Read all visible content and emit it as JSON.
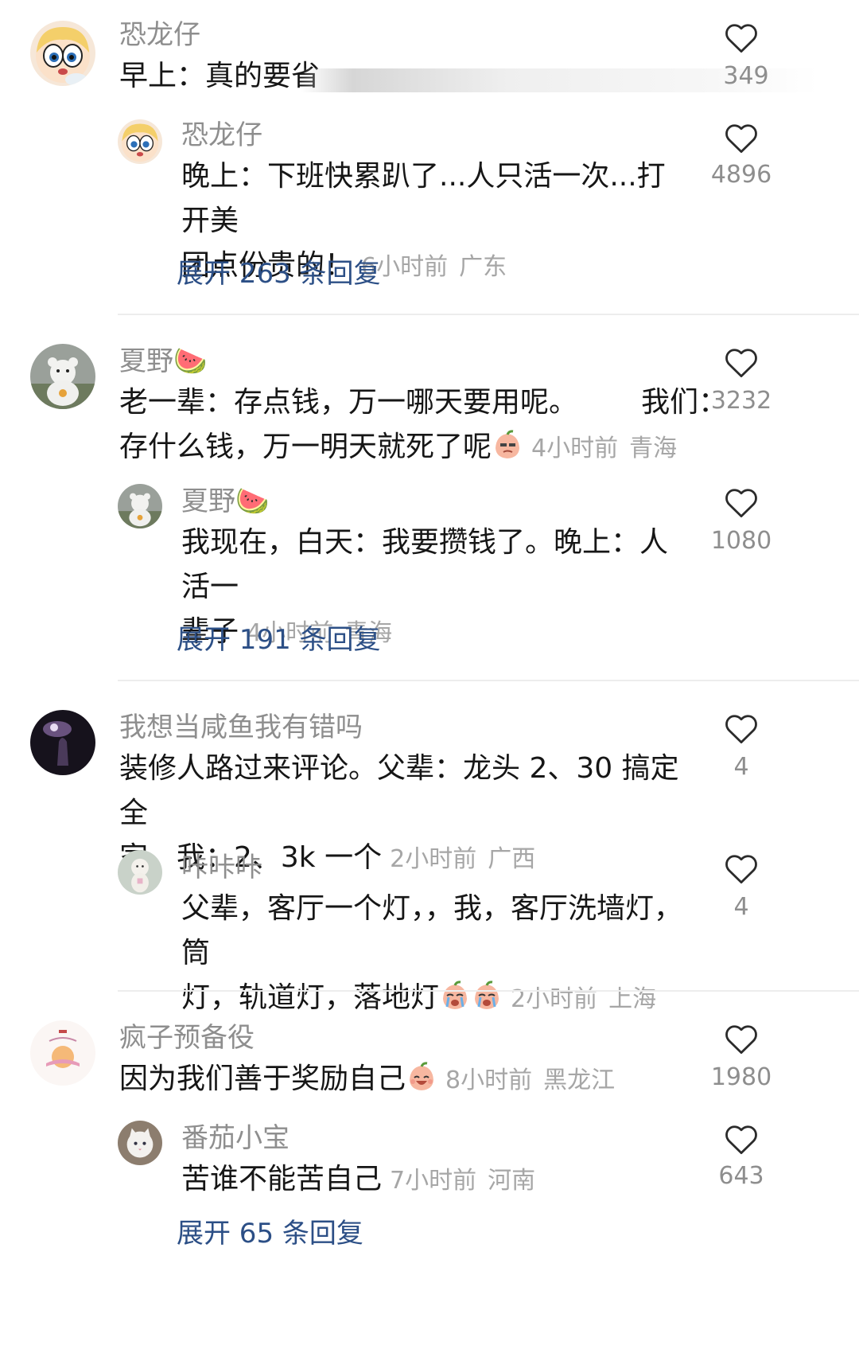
{
  "comments": [
    {
      "username": "恐龙仔",
      "text": "早上：真的要省",
      "likes": "349",
      "reply": {
        "username": "恐龙仔",
        "text_line1": "晚上：下班快累趴了...人只活一次...打开美",
        "text_line2": "团点份贵的！",
        "time": "6小时前",
        "location": "广东",
        "likes": "4896"
      },
      "expand_label": "展开 263 条回复"
    },
    {
      "username": "夏野🍉",
      "text_line1": "老一辈：存点钱，万一哪天要用呢。       我们：",
      "text_line2": "存什么钱，万一明天就死了呢",
      "time": "4小时前",
      "location": "青海",
      "likes": "3232",
      "reply": {
        "username": "夏野🍉",
        "text_line1": "我现在，白天：我要攒钱了。晚上：人活一",
        "text_line2": "辈子",
        "time": "4小时前",
        "location": "青海",
        "likes": "1080"
      },
      "expand_label": "展开 191 条回复"
    },
    {
      "username": "我想当咸鱼我有错吗",
      "text_line1": "装修人路过来评论。父辈：龙头 2、30 搞定全",
      "text_line2": "家。我：2、3k 一个",
      "time": "2小时前",
      "location": "广西",
      "likes": "4",
      "reply": {
        "username": "咔咔咔",
        "text_line1": "父辈，客厅一个灯，，我，客厅洗墙灯，筒",
        "text_line2": "灯，轨道灯，落地灯",
        "time": "2小时前",
        "location": "上海",
        "likes": "4"
      }
    },
    {
      "username": "疯子预备役",
      "text": "因为我们善于奖励自己",
      "time": "8小时前",
      "location": "黑龙江",
      "likes": "1980",
      "reply": {
        "username": "番茄小宝",
        "text": "苦谁不能苦自己",
        "time": "7小时前",
        "location": "河南",
        "likes": "643"
      },
      "expand_label": "展开 65 条回复"
    }
  ],
  "colors": {
    "link": "#2c4f86",
    "name": "#8e8e8e",
    "meta": "#a6a6a6",
    "divider": "#ededed"
  },
  "icons": [
    "heart-outline-icon",
    "watermelon-emoji",
    "peach-smirk-emoji",
    "peach-cry-emoji",
    "peach-laugh-emoji"
  ]
}
